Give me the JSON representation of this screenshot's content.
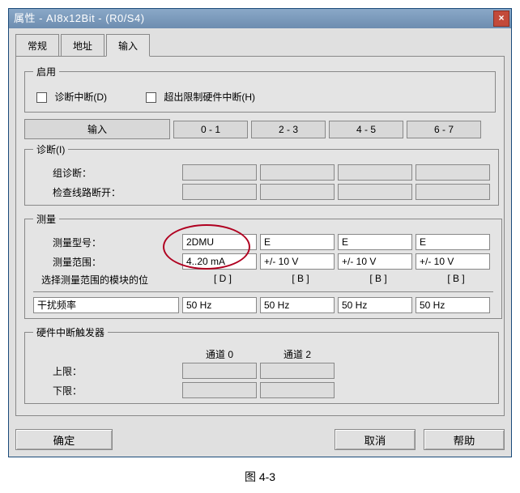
{
  "window": {
    "title": "属性 - AI8x12Bit - (R0/S4)",
    "close": "×"
  },
  "tabs": {
    "t0": "常规",
    "t1": "地址",
    "t2": "输入"
  },
  "enable": {
    "legend": "启用",
    "diag_interrupt": "诊断中断(D)",
    "hw_interrupt": "超出限制硬件中断(H)"
  },
  "cols": {
    "label": "输入",
    "c0": "0 - 1",
    "c1": "2 - 3",
    "c2": "4 - 5",
    "c3": "6 - 7"
  },
  "diag": {
    "legend": "诊断(I)",
    "group": "组诊断：",
    "wirebreak": "检查线路断开："
  },
  "meas": {
    "legend": "测量",
    "type_label": "测量型号：",
    "range_label": "测量范围：",
    "type": {
      "c0": "2DMU",
      "c1": "E",
      "c2": "E",
      "c3": "E"
    },
    "range": {
      "c0": "4..20 mA",
      "c1": "+/- 10 V",
      "c2": "+/- 10 V",
      "c3": "+/- 10 V"
    },
    "modpos_label": "选择测量范围的模块的位",
    "modpos": {
      "c0": "[ D ]",
      "c1": "[ B ]",
      "c2": "[ B ]",
      "c3": "[ B ]"
    },
    "noise_label": "干扰频率",
    "noise": {
      "c0": "50 Hz",
      "c1": "50 Hz",
      "c2": "50 Hz",
      "c3": "50 Hz"
    }
  },
  "hw": {
    "legend": "硬件中断触发器",
    "ch0": "通道 0",
    "ch2": "通道 2",
    "hi": "上限：",
    "lo": "下限："
  },
  "buttons": {
    "ok": "确定",
    "cancel": "取消",
    "help": "帮助"
  },
  "caption": "图 4-3"
}
